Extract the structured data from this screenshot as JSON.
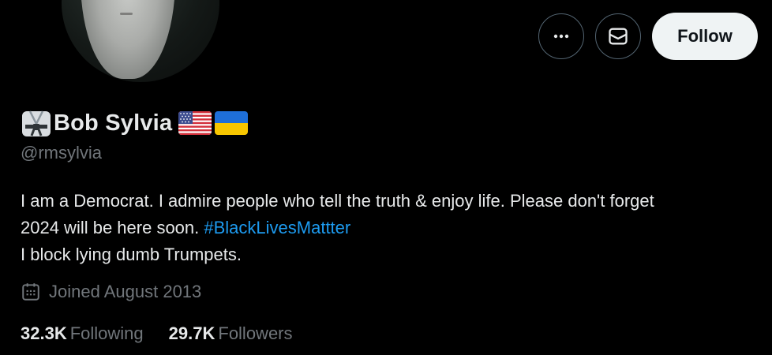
{
  "profile": {
    "display_name": "Bob Sylvia",
    "handle": "@rmsylvia",
    "icons": [
      "martial-arts-uniform-icon",
      "us-flag-icon",
      "ukraine-flag-icon"
    ]
  },
  "actions": {
    "more_icon": "more-icon",
    "message_icon": "mail-icon",
    "follow_label": "Follow"
  },
  "bio": {
    "line1": "I am a Democrat. I admire people who tell the truth & enjoy life.  Please don't forget",
    "line2_text": "2024 will be here soon. ",
    "hashtag": "#BlackLivesMattter",
    "line3": "I block lying dumb Trumpets."
  },
  "joined": {
    "icon": "calendar-icon",
    "text": "Joined August 2013"
  },
  "stats": {
    "following_count": "32.3K",
    "following_label": "Following",
    "followers_count": "29.7K",
    "followers_label": "Followers"
  },
  "colors": {
    "background": "#000000",
    "text_primary": "#e7e9ea",
    "text_secondary": "#71767b",
    "link": "#1d9bf0",
    "follow_button_bg": "#eff3f4"
  }
}
